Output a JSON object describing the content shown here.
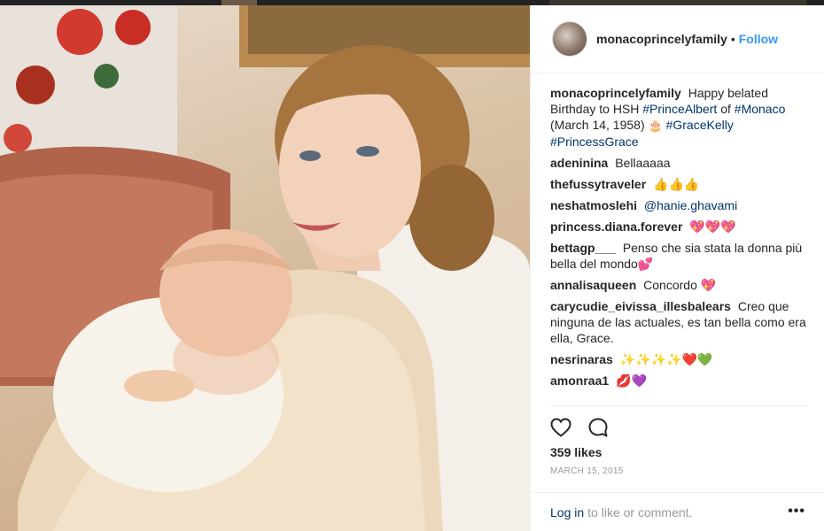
{
  "header": {
    "username": "monacoprincelyfamily",
    "separator": "•",
    "follow_label": "Follow"
  },
  "caption": {
    "username": "monacoprincelyfamily",
    "text_1": "Happy belated Birthday to HSH",
    "tag_1": "#PrinceAlbert",
    "text_2": "of",
    "tag_2": "#Monaco",
    "text_3": "(March 14, 1958)",
    "emoji": "🎂",
    "tag_3": "#GraceKelly",
    "tag_4": "#PrincessGrace"
  },
  "comments": [
    {
      "user": "adeninina",
      "text": "Bellaaaaa"
    },
    {
      "user": "thefussytraveler",
      "text": "👍👍👍"
    },
    {
      "user": "neshatmoslehi",
      "text": "@hanie.ghavami"
    },
    {
      "user": "princess.diana.forever",
      "text": "💖💖💖"
    },
    {
      "user": "bettagp___",
      "text": "Penso che sia stata la donna più bella del mondo💕"
    },
    {
      "user": "annalisaqueen",
      "text": "Concordo 💖"
    },
    {
      "user": "carycudie_eivissa_illesbalears",
      "text": "Creo que ninguna de las actuales, es tan bella como era ella, Grace."
    },
    {
      "user": "nesrinaras",
      "text": "✨✨✨✨❤️💚"
    },
    {
      "user": "amonraa1",
      "text": "💋💜"
    }
  ],
  "likes": "359 likes",
  "date": "MARCH 15, 2015",
  "footer": {
    "login_label": "Log in",
    "rest_text": "to like or comment.",
    "more_label": "•••"
  },
  "icons": {
    "like": "heart-icon",
    "comment": "comment-bubble-icon",
    "more": "more-options-icon"
  }
}
